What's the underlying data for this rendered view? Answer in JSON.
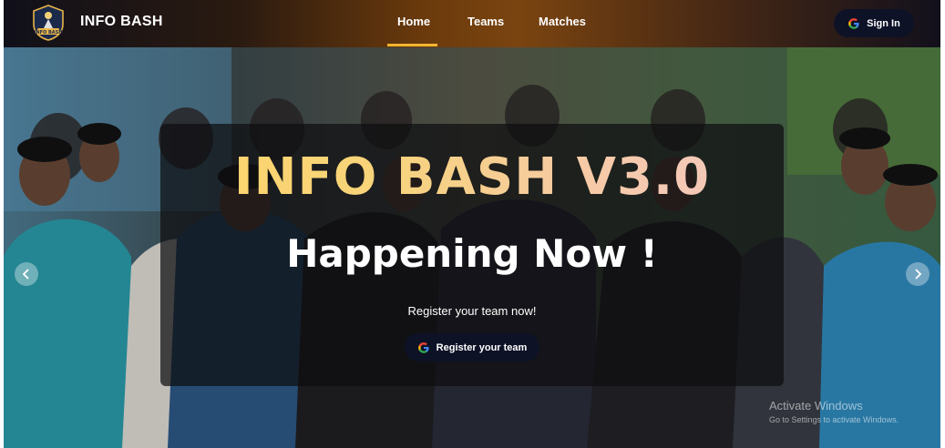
{
  "navbar": {
    "brand": "INFO BASH",
    "links": [
      {
        "label": "Home",
        "active": true
      },
      {
        "label": "Teams",
        "active": false
      },
      {
        "label": "Matches",
        "active": false
      }
    ],
    "signin_label": "Sign In",
    "logo_text": "INFO BASH",
    "accent": "#f2b531"
  },
  "hero": {
    "headline": "INFO BASH V3.0",
    "subhead": "Happening Now !",
    "cta_text": "Register your team now!",
    "register_label": "Register your team",
    "prev_icon": "chevron-left-icon",
    "next_icon": "chevron-right-icon"
  },
  "watermark": {
    "title": "Activate Windows",
    "subtitle": "Go to Settings to activate Windows."
  }
}
